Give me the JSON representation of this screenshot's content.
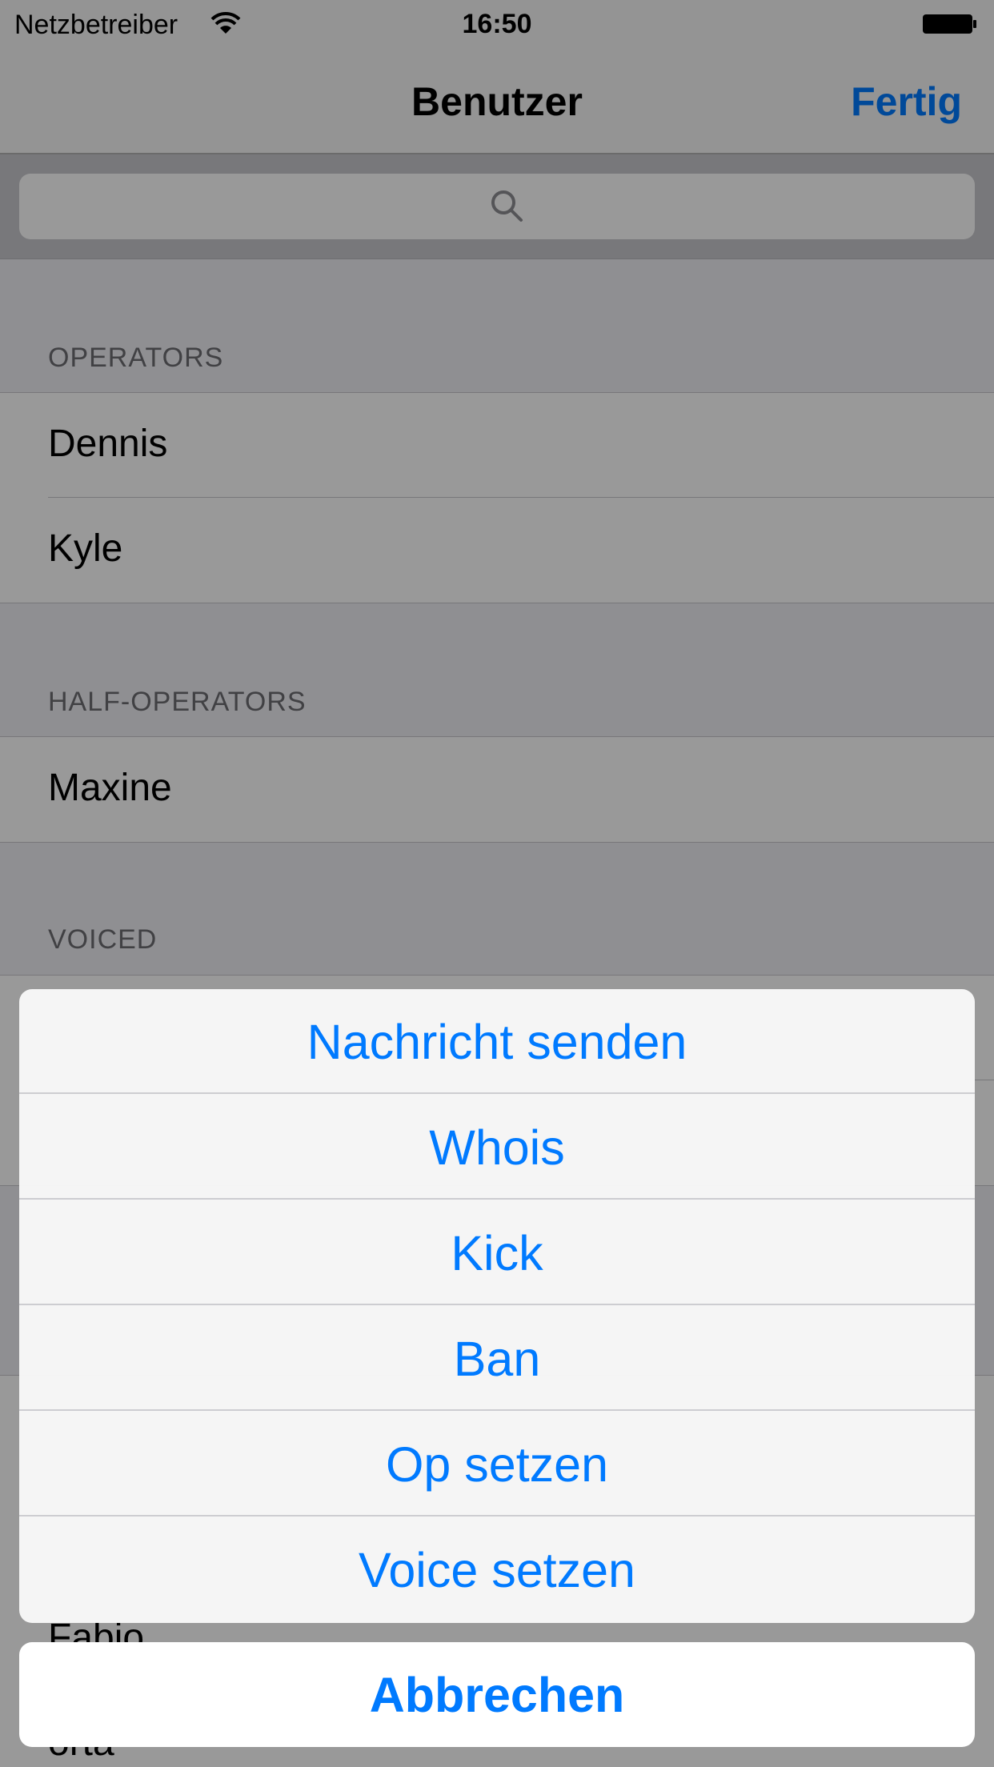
{
  "status_bar": {
    "carrier": "Netzbetreiber",
    "time": "16:50"
  },
  "nav_bar": {
    "title": "Benutzer",
    "done_label": "Fertig"
  },
  "search": {
    "placeholder": ""
  },
  "sections": [
    {
      "header": "OPERATORS",
      "users": [
        "Dennis",
        "Kyle"
      ]
    },
    {
      "header": "HALF-OPERATORS",
      "users": [
        "Maxine"
      ]
    },
    {
      "header": "VOICED",
      "users": []
    }
  ],
  "partially_hidden_users": [
    "Fabio",
    "orta"
  ],
  "action_sheet": {
    "actions": [
      "Nachricht senden",
      "Whois",
      "Kick",
      "Ban",
      "Op setzen",
      "Voice setzen"
    ],
    "cancel_label": "Abbrechen"
  },
  "colors": {
    "tint": "#007aff",
    "dim_overlay": "rgba(0,0,0,0.4)"
  }
}
